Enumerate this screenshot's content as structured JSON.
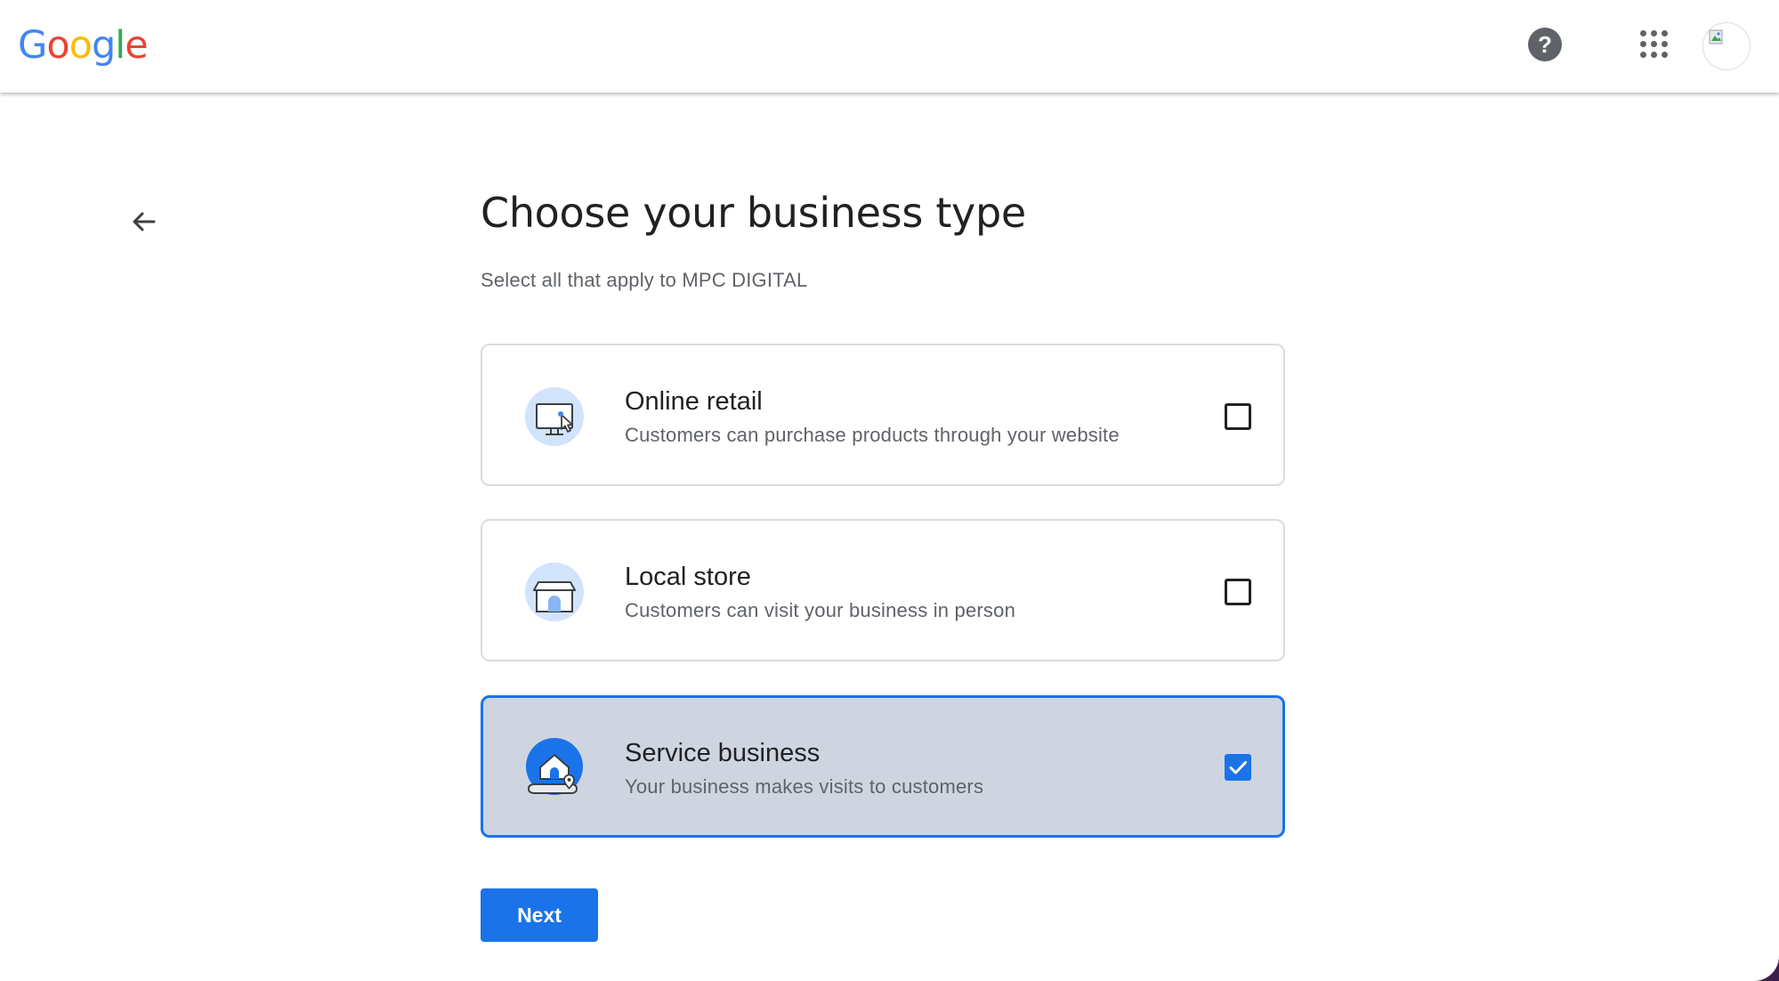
{
  "header": {
    "logo": {
      "letters": [
        "G",
        "o",
        "o",
        "g",
        "l",
        "e"
      ]
    },
    "help_icon": "?",
    "apps_icon": "apps-grid-icon",
    "avatar_icon": "account-avatar-icon"
  },
  "page": {
    "back_icon": "arrow-back-icon",
    "title": "Choose your business type",
    "subtitle": "Select all that apply to MPC DIGITAL"
  },
  "options": [
    {
      "label": "Online retail",
      "description": "Customers can purchase products through your website",
      "icon": "monitor-cursor-icon",
      "checked": false
    },
    {
      "label": "Local store",
      "description": "Customers can visit your business in person",
      "icon": "storefront-icon",
      "checked": false
    },
    {
      "label": "Service business",
      "description": "Your business makes visits to customers",
      "icon": "home-location-icon",
      "checked": true
    }
  ],
  "actions": {
    "next_label": "Next"
  },
  "colors": {
    "accent": "#1a73e8",
    "selected_card_bg": "#ced5e1",
    "text_primary": "#202124",
    "text_secondary": "#5f6368"
  }
}
